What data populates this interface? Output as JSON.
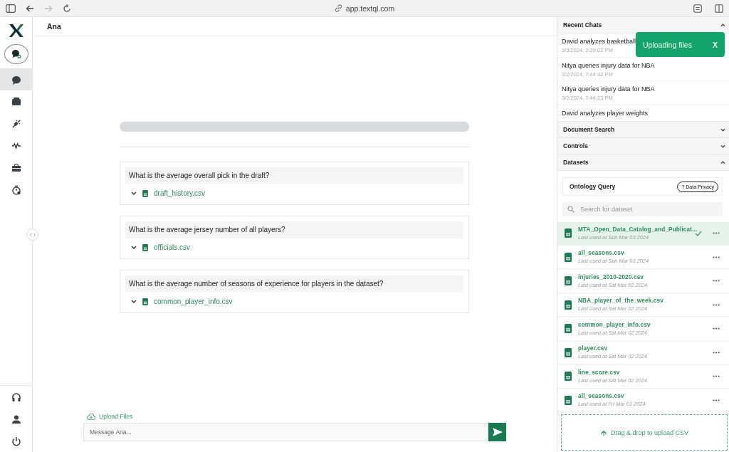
{
  "browser": {
    "url": "app.textql.com"
  },
  "sidebar": {
    "nav": [
      {
        "selected": true
      },
      {
        "selected": false
      },
      {
        "selected": false
      },
      {
        "selected": false
      },
      {
        "selected": false
      },
      {
        "selected": false
      }
    ]
  },
  "header": {
    "title": "Ana"
  },
  "questions": [
    {
      "question": "What is the average overall pick in the draft?",
      "file": "draft_history.csv"
    },
    {
      "question": "What is the average jersey number of all players?",
      "file": "officials.csv"
    },
    {
      "question": "What is the average number of seasons of experience for players in the dataset?",
      "file": "common_player_info.csv"
    }
  ],
  "composer": {
    "upload_label": "Upload Files",
    "placeholder": "Message Ana..."
  },
  "toast": {
    "text": "Uploading files",
    "close": "X"
  },
  "panel": {
    "sections": [
      {
        "title": "Recent Chats",
        "expanded": true,
        "kind": "chats",
        "items": [
          {
            "title": "David analyzes basketball",
            "date": "3/3/2024, 2:29:02 PM"
          },
          {
            "title": "Nitya queries injury data for NBA",
            "date": "3/2/2024, 7:44:32 PM"
          },
          {
            "title": "Nitya queries injury data for NBA",
            "date": "3/2/2024, 7:44:23 PM"
          },
          {
            "title": "David analyzes player weights"
          }
        ]
      },
      {
        "title": "Document Search",
        "expanded": false
      },
      {
        "title": "Controls",
        "expanded": false
      },
      {
        "title": "Datasets",
        "expanded": true,
        "kind": "datasets",
        "ontology": {
          "title": "Ontology Query",
          "privacy": "? Data Privacy"
        },
        "search_placeholder": "Search for dataset",
        "items": [
          {
            "name": "MTA_Open_Data_Catalog_and_Publicat...",
            "used": "Last used at Sun Mar 03 2024",
            "selected": true
          },
          {
            "name": "all_seasons.csv",
            "used": "Last used at Sun Mar 03 2024",
            "selected": false
          },
          {
            "name": "injuries_2010-2020.csv",
            "used": "Last used at Sat Mar 02 2024",
            "selected": false
          },
          {
            "name": "NBA_player_of_the_week.csv",
            "used": "Last used at Sat Mar 02 2024",
            "selected": false
          },
          {
            "name": "common_player_info.csv",
            "used": "Last used at Sat Mar 02 2024",
            "selected": false
          },
          {
            "name": "player.csv",
            "used": "Last used at Sat Mar 02 2024",
            "selected": false
          },
          {
            "name": "line_score.csv",
            "used": "Last used at Sat Mar 02 2024",
            "selected": false
          },
          {
            "name": "all_seasons.csv",
            "used": "Last used at Fri Mar 01 2024",
            "selected": false
          }
        ],
        "dropzone": "Drag & drop to upload CSV"
      }
    ]
  }
}
